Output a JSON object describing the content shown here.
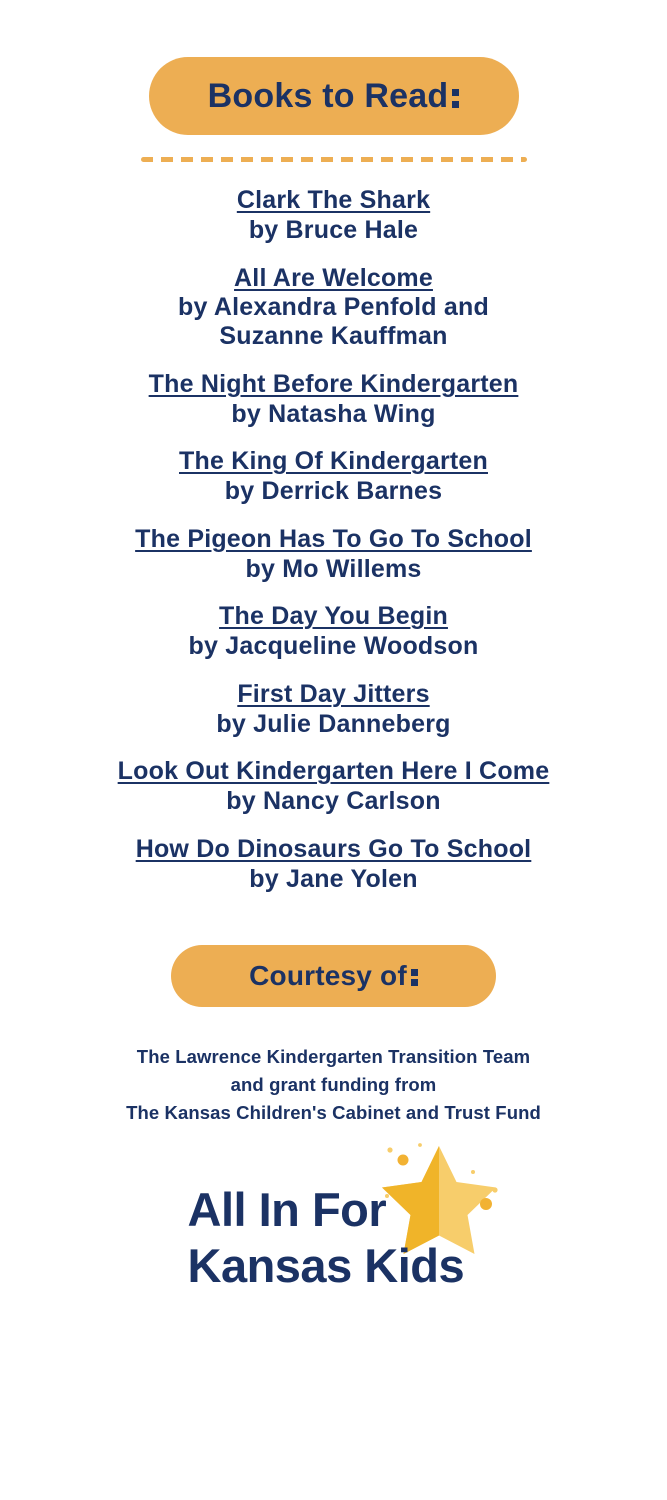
{
  "colors": {
    "navy": "#1b3264",
    "orange": "#edae53",
    "star_gold": "#f0b429",
    "star_gold_light": "#f7cd6b",
    "background": "#ffffff"
  },
  "header": {
    "banner_label": "Books to Read",
    "banner_colon": ":"
  },
  "divider": {
    "style": "dashed-orange-rule"
  },
  "books": [
    {
      "title": "Clark The Shark",
      "author": "by Bruce Hale"
    },
    {
      "title": "All Are Welcome",
      "author": "by Alexandra Penfold and\nSuzanne Kauffman"
    },
    {
      "title": "The Night Before Kindergarten",
      "author": "by Natasha Wing"
    },
    {
      "title": "The King Of Kindergarten",
      "author": "by Derrick Barnes"
    },
    {
      "title": "The Pigeon Has To Go To School",
      "author": "by Mo Willems"
    },
    {
      "title": "The Day You Begin",
      "author": "by Jacqueline Woodson"
    },
    {
      "title": "First Day Jitters",
      "author": "by Julie Danneberg"
    },
    {
      "title": "Look Out Kindergarten Here I Come",
      "author": "by Nancy Carlson"
    },
    {
      "title": "How Do Dinosaurs Go To School",
      "author": "by Jane Yolen"
    }
  ],
  "courtesy": {
    "banner_label": "Courtesy of",
    "banner_colon": ":",
    "credit_lines": [
      "The Lawrence Kindergarten Transition Team",
      "and grant funding from",
      "The Kansas Children's Cabinet and Trust Fund"
    ]
  },
  "logo": {
    "line1": "All In For",
    "line2": "Kansas Kids",
    "star_icon": "star-icon"
  }
}
